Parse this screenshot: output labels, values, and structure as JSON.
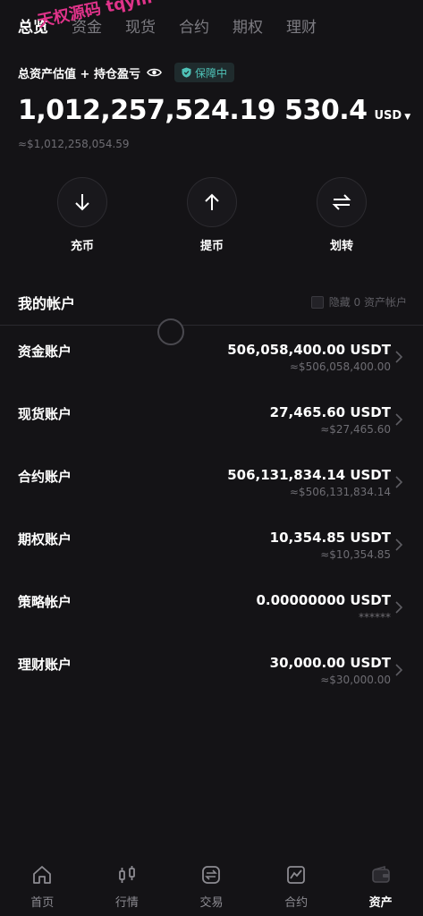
{
  "top_tabs": [
    {
      "label": "总览",
      "active": true
    },
    {
      "label": "资金",
      "active": false
    },
    {
      "label": "现货",
      "active": false
    },
    {
      "label": "合约",
      "active": false
    },
    {
      "label": "期权",
      "active": false
    },
    {
      "label": "理财",
      "active": false
    }
  ],
  "watermark": "天权源码 tqym",
  "asset_header": {
    "label": "总资产估值 + 持仓盈亏",
    "eye_icon": "eye-icon",
    "badge": "保障中",
    "badge_icon": "shield-icon"
  },
  "totals": {
    "value": "1,012,257,524.19",
    "pnl": "530.4",
    "currency": "USD",
    "approx": "≈$1,012,258,054.59"
  },
  "actions": [
    {
      "label": "充币",
      "icon": "arrow-down-icon"
    },
    {
      "label": "提币",
      "icon": "arrow-up-icon"
    },
    {
      "label": "划转",
      "icon": "transfer-icon"
    }
  ],
  "accounts_section": {
    "title": "我的帐户",
    "hide_label": "隐藏 0 资产帐户"
  },
  "accounts": [
    {
      "name": "资金账户",
      "amount": "506,058,400.00 USDT",
      "approx": "≈$506,058,400.00"
    },
    {
      "name": "现货账户",
      "amount": "27,465.60 USDT",
      "approx": "≈$27,465.60"
    },
    {
      "name": "合约账户",
      "amount": "506,131,834.14 USDT",
      "approx": "≈$506,131,834.14"
    },
    {
      "name": "期权账户",
      "amount": "10,354.85 USDT",
      "approx": "≈$10,354.85"
    },
    {
      "name": "策略帐户",
      "amount": "0.00000000 USDT",
      "approx": "******"
    },
    {
      "name": "理财账户",
      "amount": "30,000.00 USDT",
      "approx": "≈$30,000.00"
    }
  ],
  "bottom_nav": [
    {
      "label": "首页",
      "icon": "home-icon",
      "active": false
    },
    {
      "label": "行情",
      "icon": "candlestick-icon",
      "active": false
    },
    {
      "label": "交易",
      "icon": "exchange-icon",
      "active": false
    },
    {
      "label": "合约",
      "icon": "contract-chart-icon",
      "active": false
    },
    {
      "label": "资产",
      "icon": "wallet-icon",
      "active": true
    }
  ],
  "colors": {
    "background": "#141316",
    "text_primary": "#ffffff",
    "text_secondary": "#6e6d73",
    "badge_accent": "#4fc3b8",
    "watermark": "#e0338a"
  }
}
